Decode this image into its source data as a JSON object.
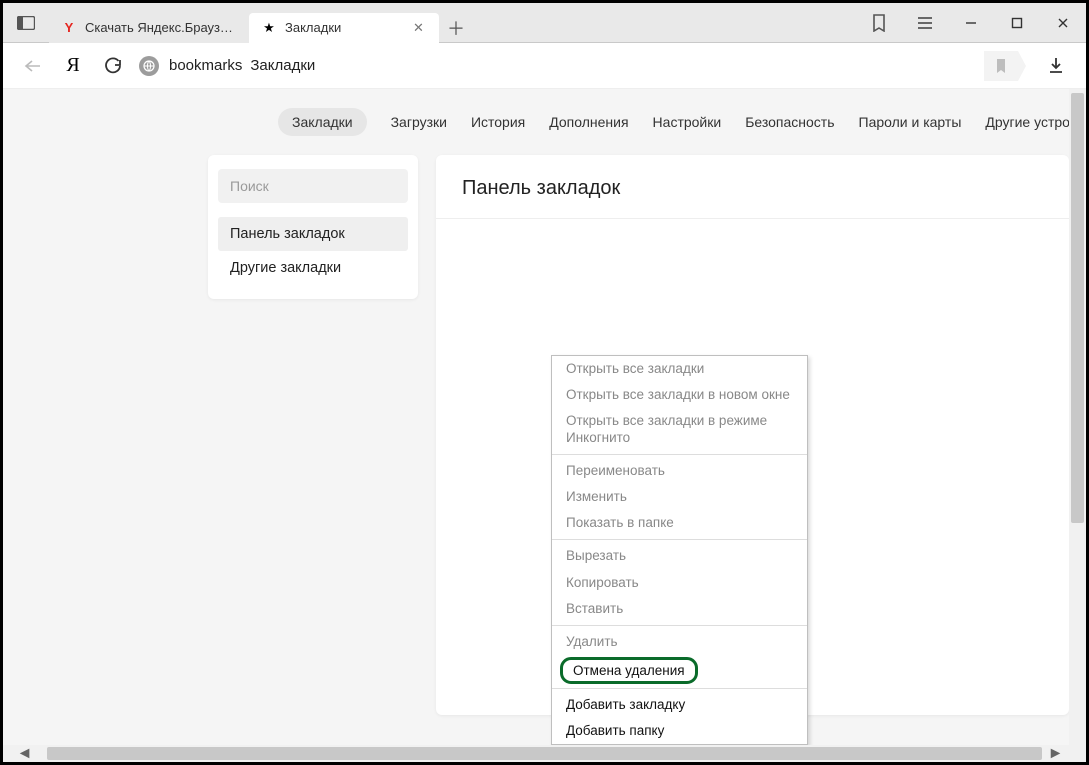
{
  "window": {
    "tabs": [
      {
        "title": "Скачать Яндекс.Браузер д",
        "fav": "Y",
        "active": false
      },
      {
        "title": "Закладки",
        "fav": "★",
        "active": true
      }
    ]
  },
  "omnibox": {
    "path": "bookmarks",
    "title": "Закладки"
  },
  "settings_nav": {
    "items": [
      "Закладки",
      "Загрузки",
      "История",
      "Дополнения",
      "Настройки",
      "Безопасность",
      "Пароли и карты",
      "Другие устройства"
    ],
    "active_index": 0
  },
  "sidebar": {
    "search_placeholder": "Поиск",
    "items": [
      "Панель закладок",
      "Другие закладки"
    ],
    "active_index": 0
  },
  "main": {
    "heading": "Панель закладок"
  },
  "context_menu": {
    "groups": [
      {
        "items": [
          {
            "label": "Открыть все закладки",
            "enabled": false
          },
          {
            "label": "Открыть все закладки в новом окне",
            "enabled": false
          },
          {
            "label": "Открыть все закладки в режиме Инкогнито",
            "enabled": false
          }
        ]
      },
      {
        "items": [
          {
            "label": "Переименовать",
            "enabled": false
          },
          {
            "label": "Изменить",
            "enabled": false
          },
          {
            "label": "Показать в папке",
            "enabled": false
          }
        ]
      },
      {
        "items": [
          {
            "label": "Вырезать",
            "enabled": false
          },
          {
            "label": "Копировать",
            "enabled": false
          },
          {
            "label": "Вставить",
            "enabled": false
          }
        ]
      },
      {
        "items": [
          {
            "label": "Удалить",
            "enabled": false
          },
          {
            "label": "Отмена удаления",
            "enabled": true,
            "highlight": true
          }
        ]
      },
      {
        "items": [
          {
            "label": "Добавить закладку",
            "enabled": true
          },
          {
            "label": "Добавить папку",
            "enabled": true
          }
        ]
      }
    ]
  }
}
